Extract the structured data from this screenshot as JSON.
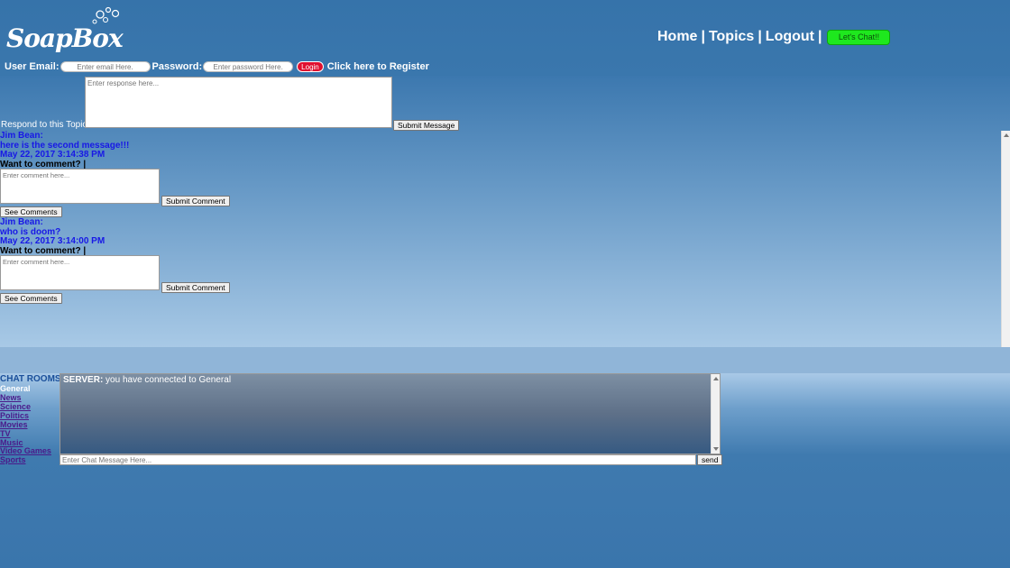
{
  "brand": {
    "logo_text": "SoapBox"
  },
  "nav": {
    "home": "Home",
    "topics": "Topics",
    "logout": "Logout",
    "separator": "|",
    "chat_button": "Let's Chat!!"
  },
  "login": {
    "email_label": "User Email:",
    "email_placeholder": "Enter email Here.",
    "password_label": "Password:",
    "password_placeholder": "Enter password Here.",
    "login_button": "Login",
    "register_link": "Click here to Register"
  },
  "respond": {
    "label": "Respond to this Topic",
    "placeholder": "Enter response here...",
    "submit": "Submit Message"
  },
  "messages": [
    {
      "author": "Jim Bean:",
      "text": "here is the second message!!!",
      "date": "May 22, 2017 3:14:38 PM",
      "want_comment": "Want to comment? |",
      "comment_placeholder": "Enter comment here...",
      "submit_comment": "Submit Comment",
      "see_comments": "See Comments"
    },
    {
      "author": "Jim Bean:",
      "text": "who is doom?",
      "date": "May 22, 2017 3:14:00 PM",
      "want_comment": "Want to comment? |",
      "comment_placeholder": "Enter comment here...",
      "submit_comment": "Submit Comment",
      "see_comments": "See Comments"
    }
  ],
  "chat": {
    "rooms_title": "CHAT ROOMS",
    "rooms": [
      "General",
      "News",
      "Science",
      "Politics",
      "Movies",
      "TV",
      "Music",
      "Video Games",
      "Sports"
    ],
    "active_room": "General",
    "server_label": "SERVER:",
    "server_message": " you have connected to General",
    "input_placeholder": "Enter Chat Message Here...",
    "send_button": "send"
  },
  "colors": {
    "header_bg": "#3673aa",
    "chat_button": "#1ee81e",
    "login_button": "#e0102f",
    "message_text": "#1818e6"
  }
}
